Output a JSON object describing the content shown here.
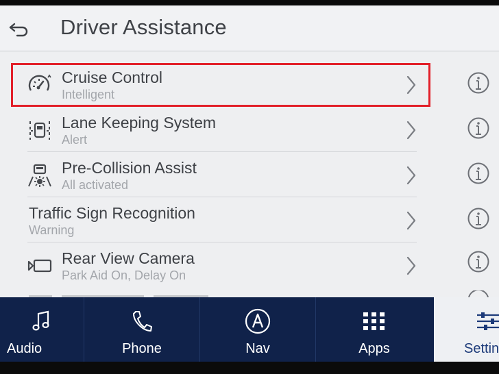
{
  "header": {
    "title": "Driver Assistance",
    "back_icon": "back-arrow-icon"
  },
  "list": {
    "items": [
      {
        "title": "Cruise Control",
        "subtitle": "Intelligent",
        "icon": "speedometer-icon",
        "selected": true
      },
      {
        "title": "Lane Keeping System",
        "subtitle": "Alert",
        "icon": "lane-keeping-icon"
      },
      {
        "title": "Pre-Collision Assist",
        "subtitle": "All activated",
        "icon": "pre-collision-icon"
      },
      {
        "title": "Traffic Sign Recognition",
        "subtitle": "Warning",
        "icon": ""
      },
      {
        "title": "Rear View Camera",
        "subtitle": "Park Aid On, Delay On",
        "icon": "rear-camera-icon"
      }
    ],
    "highlight_color": "#e2202a"
  },
  "nav": {
    "tabs": [
      {
        "label": "Audio",
        "icon": "music-note-icon"
      },
      {
        "label": "Phone",
        "icon": "phone-icon"
      },
      {
        "label": "Nav",
        "icon": "navigation-icon"
      },
      {
        "label": "Apps",
        "icon": "apps-grid-icon"
      },
      {
        "label": "Settin",
        "icon": "settings-sliders-icon",
        "active": true
      }
    ],
    "bar_color": "#10224a"
  }
}
